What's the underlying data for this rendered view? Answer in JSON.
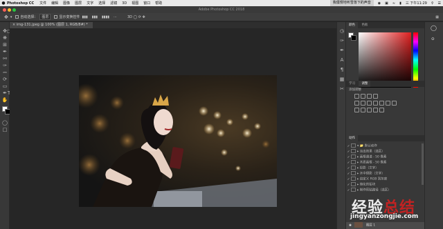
{
  "menubar": {
    "apple": "",
    "app": "Photoshop CC",
    "items": [
      "文件",
      "编辑",
      "图像",
      "图层",
      "文字",
      "选择",
      "滤镜",
      "3D",
      "视图",
      "窗口",
      "帮助"
    ],
    "notification": "我僵慢地听雪落下的声音",
    "clock": "三 下午11:29",
    "status_icons": [
      "wechat-icon",
      "cast-icon",
      "wifi-icon",
      "battery-icon",
      "search-icon",
      "menu-icon"
    ]
  },
  "window": {
    "title": "Adobe Photoshop CC 2018",
    "traffic_colors": [
      "#ff5f57",
      "#febc2e",
      "#28c840"
    ]
  },
  "options": {
    "auto_select_label": "自动选择：",
    "auto_select_value": "图层",
    "transform_label": "显示变换控件"
  },
  "document": {
    "tab_label": "img-131.jpeg @ 100% (图层 1, RGB/8#) *"
  },
  "panels": {
    "color_tabs": [
      "颜色",
      "色板"
    ],
    "adjust_tabs": [
      "学习",
      "调整"
    ],
    "adjust_add_label": "添加调整",
    "actions_tabs": [
      "动作"
    ],
    "action_set": "默认动作",
    "actions": [
      "淡出效果（选区）",
      "画框通道 - 50 像素",
      "木质画框 - 50 像素",
      "投影（文字）",
      "水中倒影（文字）",
      "自定义 RGB 到灰度",
      "熔化的铅块",
      "制作剪贴路径（选区）"
    ],
    "layer_name": "图层 1"
  },
  "watermark": {
    "cn_a": "经验",
    "cn_b": "总结",
    "en": "jingyanzongjie.com"
  },
  "colors": {
    "menubar_bg": "#e9e9e9",
    "panel_bg": "#383838",
    "canvas_bg": "#262626",
    "accent_red": "#d02020"
  }
}
